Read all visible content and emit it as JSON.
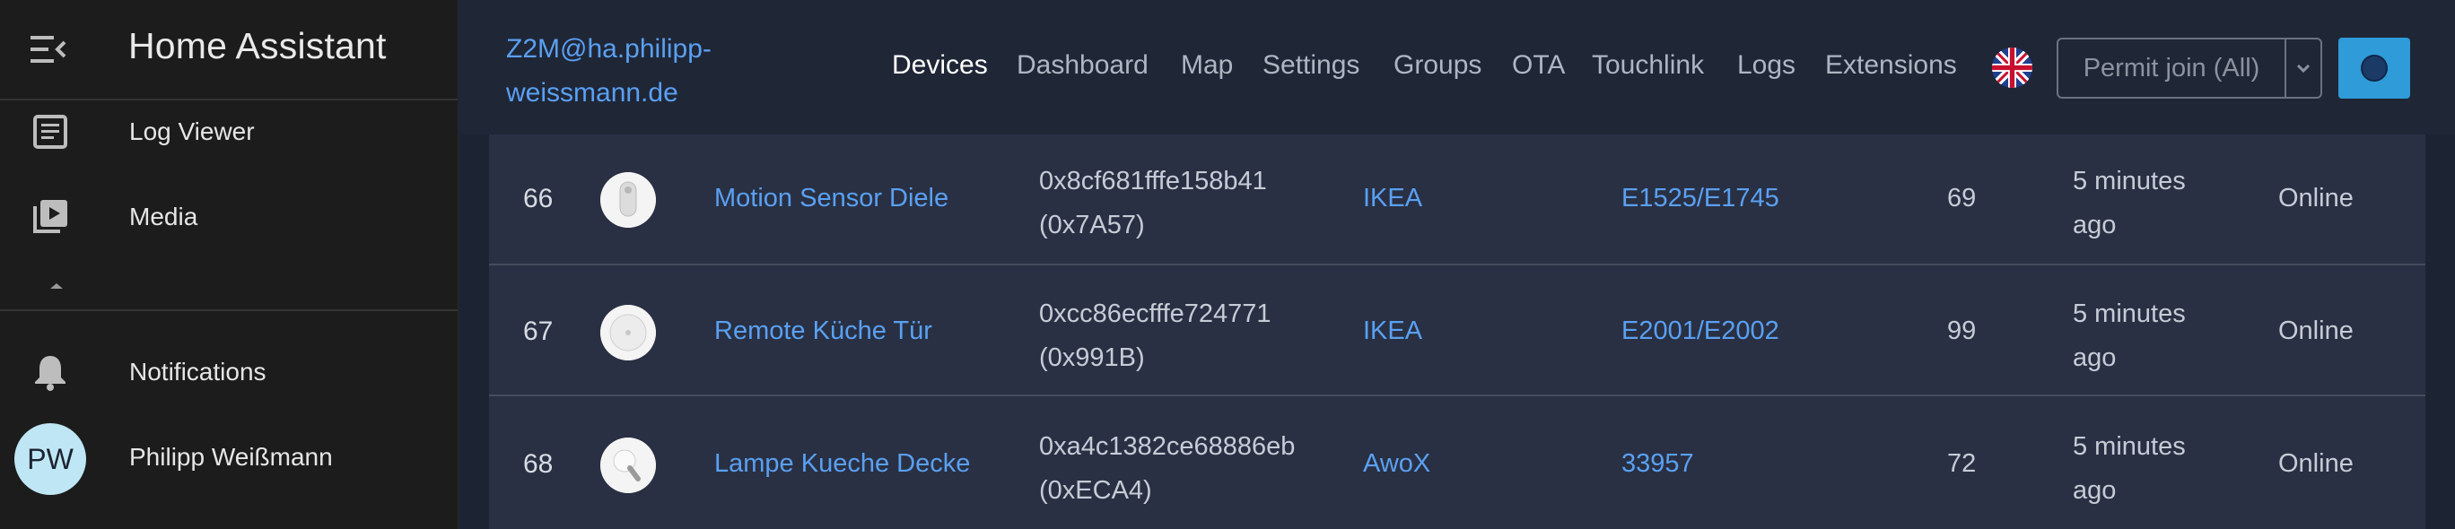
{
  "sidebar": {
    "title": "Home Assistant",
    "items": [
      {
        "label": "Log Viewer",
        "icon": "log-viewer-icon"
      },
      {
        "label": "Media",
        "icon": "media-icon"
      }
    ],
    "notifications_label": "Notifications",
    "user": {
      "initials": "PW",
      "name": "Philipp Weißmann"
    }
  },
  "topbar": {
    "host_link": "Z2M@ha.philipp-weissmann.de",
    "nav": [
      "Devices",
      "Dashboard",
      "Map",
      "Settings",
      "Groups",
      "OTA",
      "Touchlink",
      "Logs",
      "Extensions"
    ],
    "active_nav": "Devices",
    "permit_join_label": "Permit join (All)"
  },
  "devices": [
    {
      "id": "66",
      "name": "Motion Sensor Diele",
      "ieee": "0x8cf681fffe158b41",
      "nwk": "(0x7A57)",
      "vendor": "IKEA",
      "model": "E1525/E1745",
      "lqi": "69",
      "last_seen_1": "5 minutes",
      "last_seen_2": "ago",
      "status": "Online"
    },
    {
      "id": "67",
      "name": "Remote Küche Tür",
      "ieee": "0xcc86ecfffe724771",
      "nwk": "(0x991B)",
      "vendor": "IKEA",
      "model": "E2001/E2002",
      "lqi": "99",
      "last_seen_1": "5 minutes",
      "last_seen_2": "ago",
      "status": "Online"
    },
    {
      "id": "68",
      "name": "Lampe Kueche Decke",
      "ieee": "0xa4c1382ce68886eb",
      "nwk": "(0xECA4)",
      "vendor": "AwoX",
      "model": "33957",
      "lqi": "72",
      "last_seen_1": "5 minutes",
      "last_seen_2": "ago",
      "status": "Online"
    }
  ],
  "colors": {
    "accent": "#5aa0f2",
    "sidebar_bg": "#1c1c1c",
    "main_bg": "#1f2636",
    "table_bg": "#293043",
    "permit_button": "#2f9bd8"
  }
}
